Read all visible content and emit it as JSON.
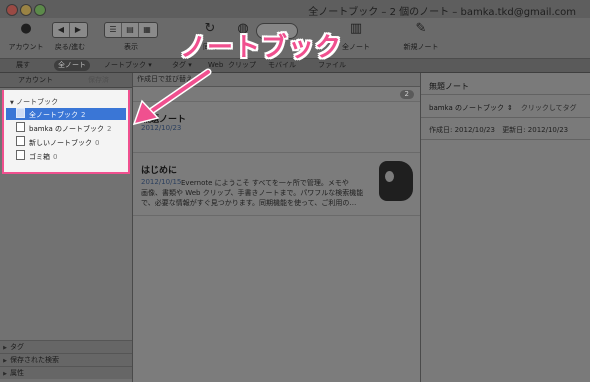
{
  "window": {
    "title": "全ノートブック – 2 個のノート – bamka.tkd@gmail.com"
  },
  "toolbar": {
    "account_label": "アカウント",
    "back_forward_label": "戻る/進む",
    "view_label": "表示",
    "sync_label": "同期",
    "activity_label": "アクティビティ",
    "search_label": "検索",
    "share_label": "共有",
    "notes_label": "全ノート",
    "new_note_label": "新規ノート"
  },
  "filterbar": {
    "shortcut": "展す",
    "all_notes": "全ノート",
    "notebook": "ノートブック ▾",
    "tag": "タグ ▾",
    "web": "Web",
    "clip": "クリップ",
    "mobile": "モバイル",
    "file": "ファイル"
  },
  "sidebar": {
    "tabs": [
      "アカウント",
      "保存済"
    ],
    "notebooks_header": "ノートブック",
    "notebooks": [
      {
        "label": "全ノートブック",
        "count": "2"
      },
      {
        "label": "bamka のノートブック",
        "count": "2"
      },
      {
        "label": "新しいノートブック",
        "count": "0"
      },
      {
        "label": "ゴミ箱",
        "count": "0"
      }
    ],
    "sections": [
      "タグ",
      "保存された検索",
      "属性"
    ]
  },
  "notelist": {
    "sort_label": "作成日で並び替え ▾",
    "count": "2",
    "notes": [
      {
        "title": "無題ノート",
        "date": "2012/10/23",
        "lines": []
      },
      {
        "title": "はじめに",
        "date": "2012/10/15",
        "lines": [
          "Evernote にようこそ すべてを一ヶ所で管理。メモや",
          "画像、書類や Web クリップ、手書きノートまで。パワフルな検索機能",
          "で、必要な情報がすぐ見つかります。同期機能を使って、ご利用の…"
        ]
      }
    ]
  },
  "detail": {
    "title": "無題ノート",
    "notebook": "bamka のノートブック",
    "tag_hint": "クリックしてタグ",
    "created_label": "作成日:",
    "created": "2012/10/23",
    "updated_label": "更新日:",
    "updated": "2012/10/23"
  },
  "annotation": {
    "callout": "ノートブック",
    "color": "#f0508f"
  }
}
